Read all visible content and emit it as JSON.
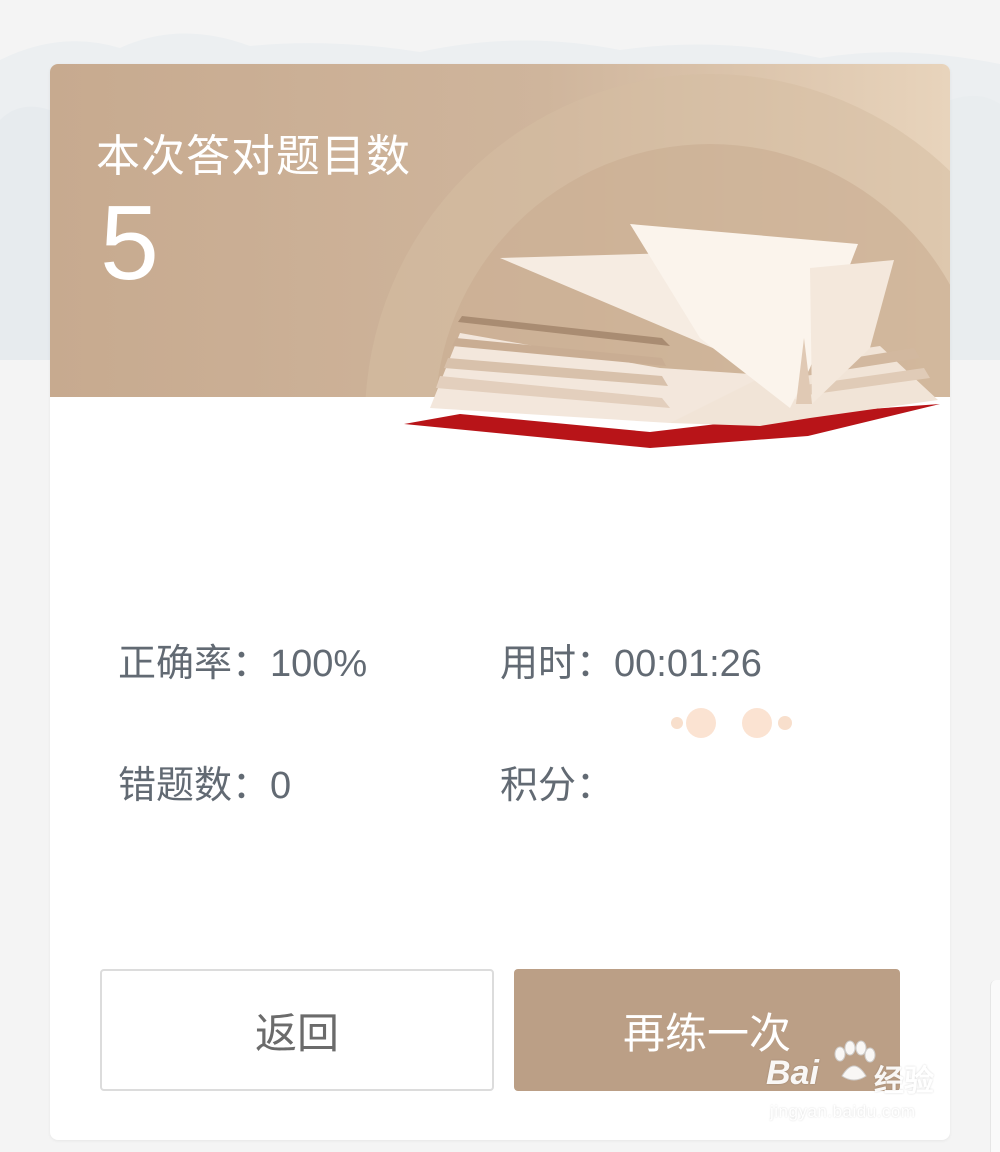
{
  "header": {
    "title": "本次答对题目数",
    "count": "5"
  },
  "stats": {
    "accuracy": {
      "label": "正确率：",
      "value": "100%"
    },
    "time": {
      "label": "用时：",
      "value": "00:01:26"
    },
    "wrong": {
      "label": "错题数：",
      "value": "0"
    },
    "points": {
      "label": "积分：",
      "state": "loading"
    }
  },
  "buttons": {
    "back_label": "返回",
    "again_label": "再练一次"
  },
  "watermark": {
    "logo_latin": "Bai",
    "logo_cn": "经验",
    "url": "jingyan.baidu.com"
  },
  "colors": {
    "header_brown": "#c7aa8f",
    "button_brown": "#bb9f86",
    "text_gray": "#626a73",
    "loading_dot": "#f8dfcc",
    "book_red": "#c0161b"
  }
}
